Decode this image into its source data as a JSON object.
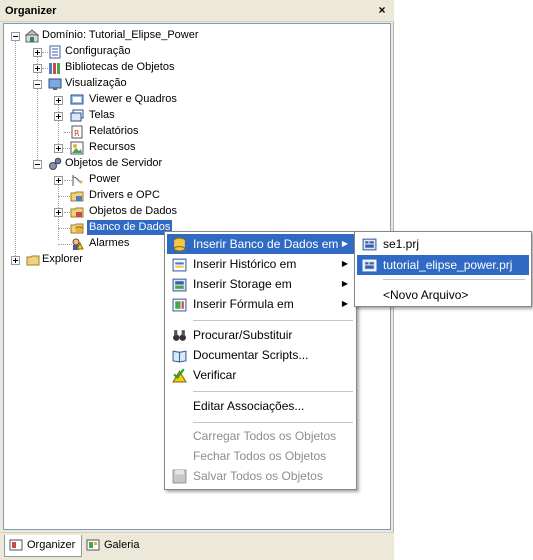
{
  "panel": {
    "title": "Organizer",
    "close_label": "×"
  },
  "tree": {
    "root": "Domínio: Tutorial_Elipse_Power",
    "configuracao": "Configuração",
    "bibliotecas": "Bibliotecas de Objetos",
    "visualizacao": "Visualização",
    "viewer_quadros": "Viewer e Quadros",
    "telas": "Telas",
    "relatorios": "Relatórios",
    "recursos": "Recursos",
    "objetos_servidor": "Objetos de Servidor",
    "power": "Power",
    "drivers_opc": "Drivers e OPC",
    "objetos_dados": "Objetos de Dados",
    "banco_dados": "Banco de Dados",
    "alarmes": "Alarmes",
    "explorer": "Explorer"
  },
  "tabs": {
    "organizer": "Organizer",
    "galeria": "Galeria"
  },
  "context_menu": {
    "inserir_banco": "Inserir Banco de Dados em",
    "inserir_historico": "Inserir Histórico em",
    "inserir_storage": "Inserir Storage em",
    "inserir_formula": "Inserir Fórmula em",
    "procurar": "Procurar/Substituir",
    "documentar": "Documentar Scripts...",
    "verificar": "Verificar",
    "editar": "Editar Associações...",
    "carregar": "Carregar Todos os Objetos",
    "fechar": "Fechar Todos os Objetos",
    "salvar": "Salvar Todos os Objetos"
  },
  "submenu": {
    "se1": "se1.prj",
    "tutorial": "tutorial_elipse_power.prj",
    "novo": "<Novo Arquivo>"
  },
  "colors": {
    "selection": "#316ac5",
    "panel_bg": "#ece9d8"
  }
}
